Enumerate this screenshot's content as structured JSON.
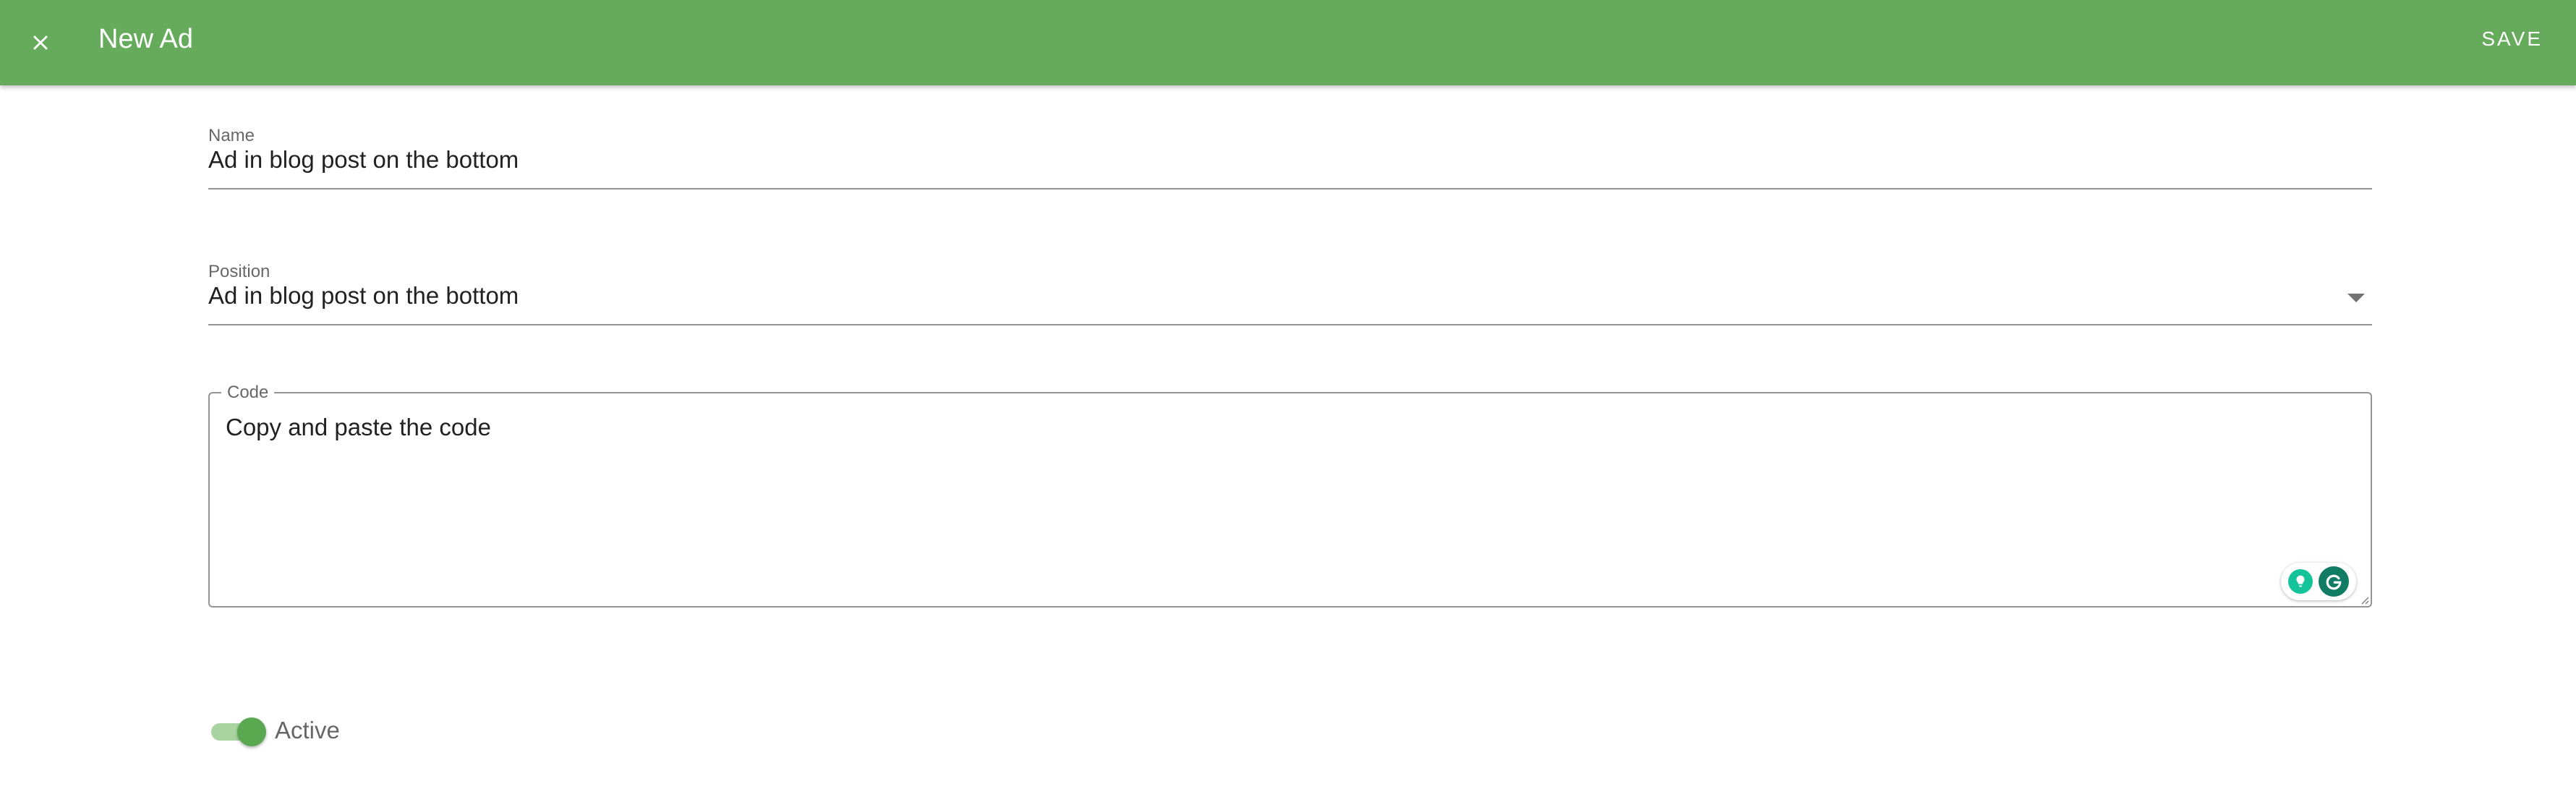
{
  "colors": {
    "appbar": "#66ab5c",
    "accent": "#5aa950",
    "switch_track": "#a9d3a1",
    "grammarly_green": "#15c39a"
  },
  "appbar": {
    "close_icon": "close-icon",
    "title": "New Ad",
    "save_label": "SAVE"
  },
  "form": {
    "name": {
      "label": "Name",
      "value": "Ad in blog post on the bottom"
    },
    "position": {
      "label": "Position",
      "selected": "Ad in blog post on the bottom",
      "icon": "dropdown-arrow-icon"
    },
    "code": {
      "label": "Code",
      "value": "Copy and paste the code"
    },
    "grammarly": {
      "icons": [
        "grammarly-suggestion-icon",
        "grammarly-logo-icon"
      ]
    },
    "active": {
      "label": "Active",
      "checked": true
    }
  }
}
